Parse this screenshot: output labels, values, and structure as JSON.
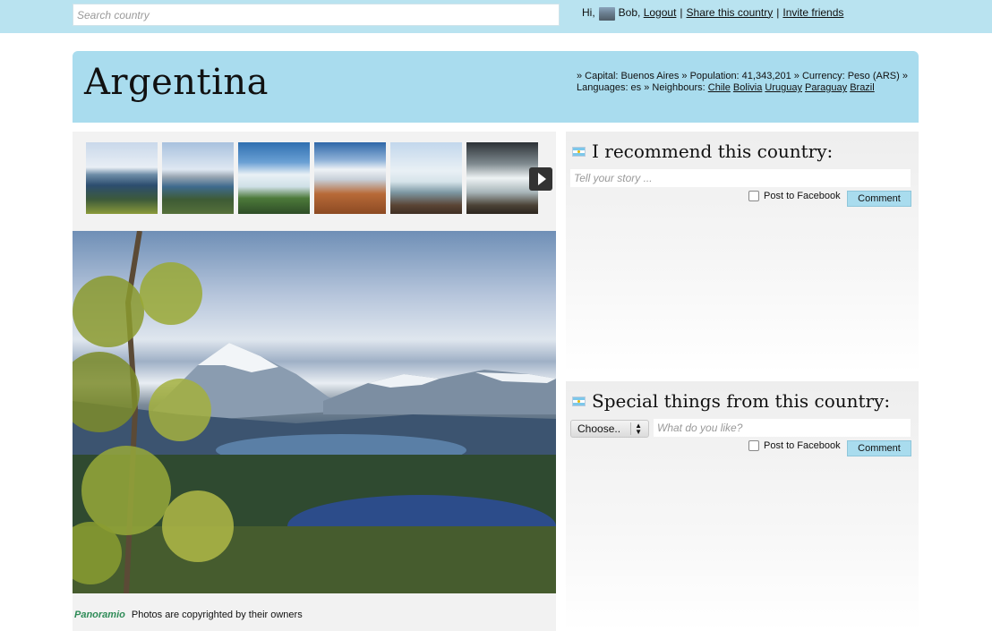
{
  "topbar": {
    "search_placeholder": "Search country",
    "greeting": "Hi,",
    "username": "Bob,",
    "logout": "Logout",
    "separator": "|",
    "share": "Share this country",
    "invite": "Invite friends"
  },
  "country": {
    "name": "Argentina",
    "facts_prefix": "» Capital: Buenos Aires » Population: 41,343,201 » Currency: Peso (ARS) » Languages: es » Neighbours:",
    "neighbours": [
      "Chile",
      "Bolivia",
      "Uruguay",
      "Paraguay",
      "Brazil"
    ]
  },
  "gallery": {
    "thumbnail_count": 6,
    "next_icon": "chevron-right-icon",
    "credit_logo": "Panoramio",
    "credit_text": "Photos are copyrighted by their owners"
  },
  "recommend": {
    "title": "I recommend this country:",
    "story_placeholder": "Tell your story ...",
    "post_facebook": "Post to Facebook",
    "comment_button": "Comment"
  },
  "special": {
    "title": "Special things from this country:",
    "select_value": "Choose..",
    "input_placeholder": "What do you like?",
    "post_facebook": "Post to Facebook",
    "comment_button": "Comment"
  },
  "colors": {
    "topbar": "#b9e3f0",
    "hero": "#a9dcee",
    "button": "#a9dcee"
  }
}
